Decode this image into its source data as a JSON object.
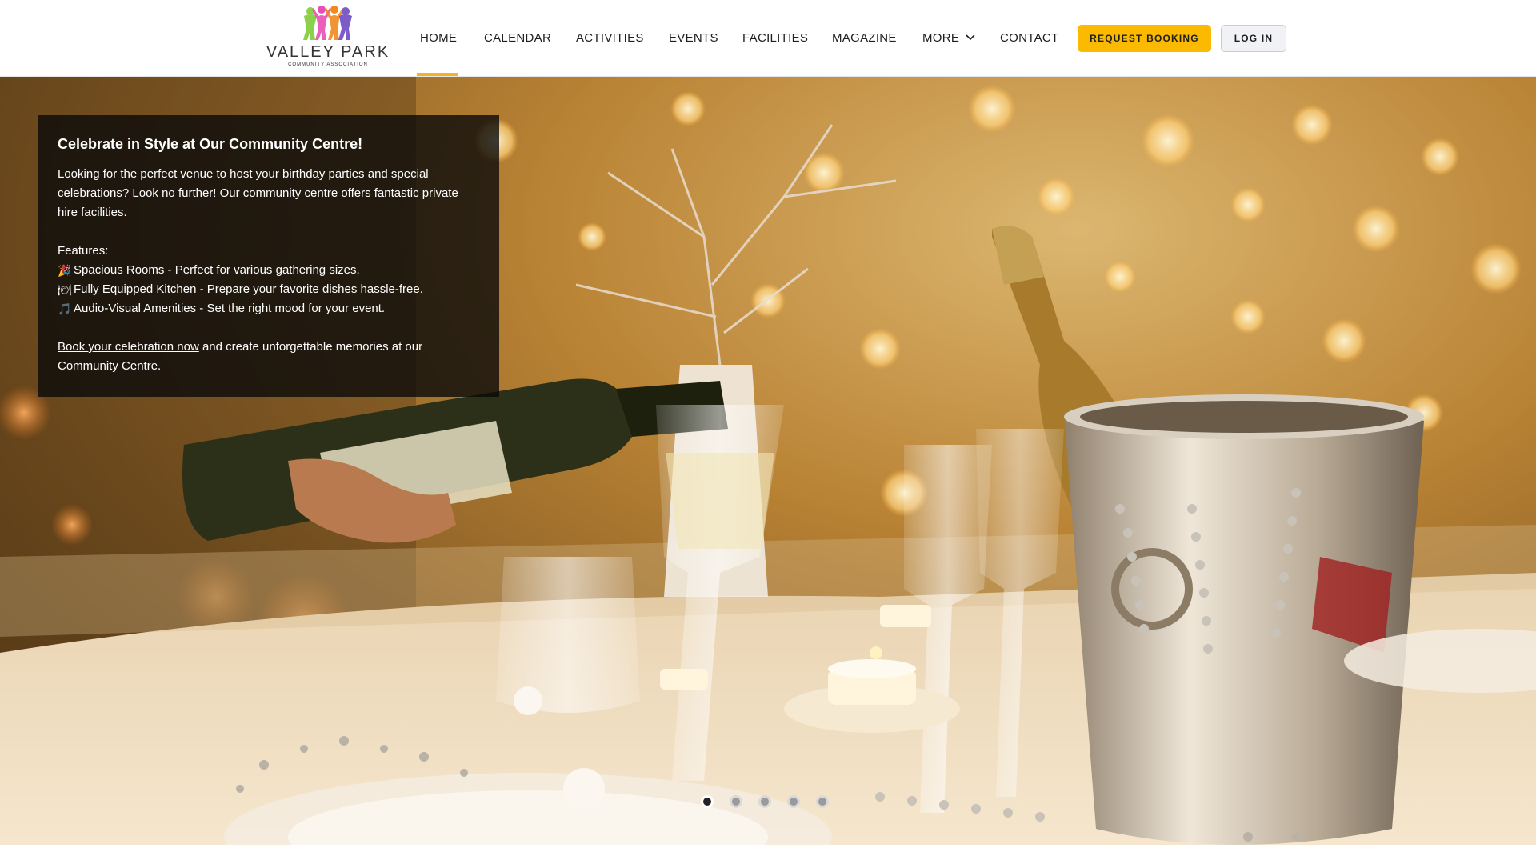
{
  "brand": {
    "name": "VALLEY PARK",
    "subtitle": "COMMUNITY ASSOCIATION",
    "logo_colors": [
      "#8bd14a",
      "#e84fb4",
      "#f08a1e",
      "#7b5cc9"
    ]
  },
  "nav": {
    "items": [
      {
        "label": "HOME",
        "active": true
      },
      {
        "label": "CALENDAR"
      },
      {
        "label": "ACTIVITIES"
      },
      {
        "label": "EVENTS"
      },
      {
        "label": "FACILITIES"
      },
      {
        "label": "MAGAZINE"
      },
      {
        "label": "MORE",
        "icon": "chevron-down-icon"
      },
      {
        "label": "CONTACT"
      }
    ],
    "booking_label": "REQUEST BOOKING",
    "login_label": "LOG IN",
    "accent": "#fbb900"
  },
  "hero": {
    "title": "Celebrate in Style at Our Community Centre!",
    "intro": "Looking for the perfect venue to host your birthday parties and special celebrations? Look no further! Our community centre offers fantastic private hire facilities.",
    "features_heading": "Features:",
    "features": [
      {
        "icon": "party-popper-icon",
        "glyph": "🎉",
        "text": "Spacious Rooms - Perfect for various gathering sizes."
      },
      {
        "icon": "plate-icon",
        "glyph": "🍽",
        "text": "Fully Equipped Kitchen - Prepare your favorite dishes hassle-free."
      },
      {
        "icon": "music-note-icon",
        "glyph": "🎵",
        "text": "Audio-Visual Amenities - Set the right mood for your event."
      }
    ],
    "cta_link": "Book your celebration now",
    "cta_rest": " and create unforgettable memories at our Community Centre.",
    "slides_count": 5,
    "active_slide": 1
  }
}
